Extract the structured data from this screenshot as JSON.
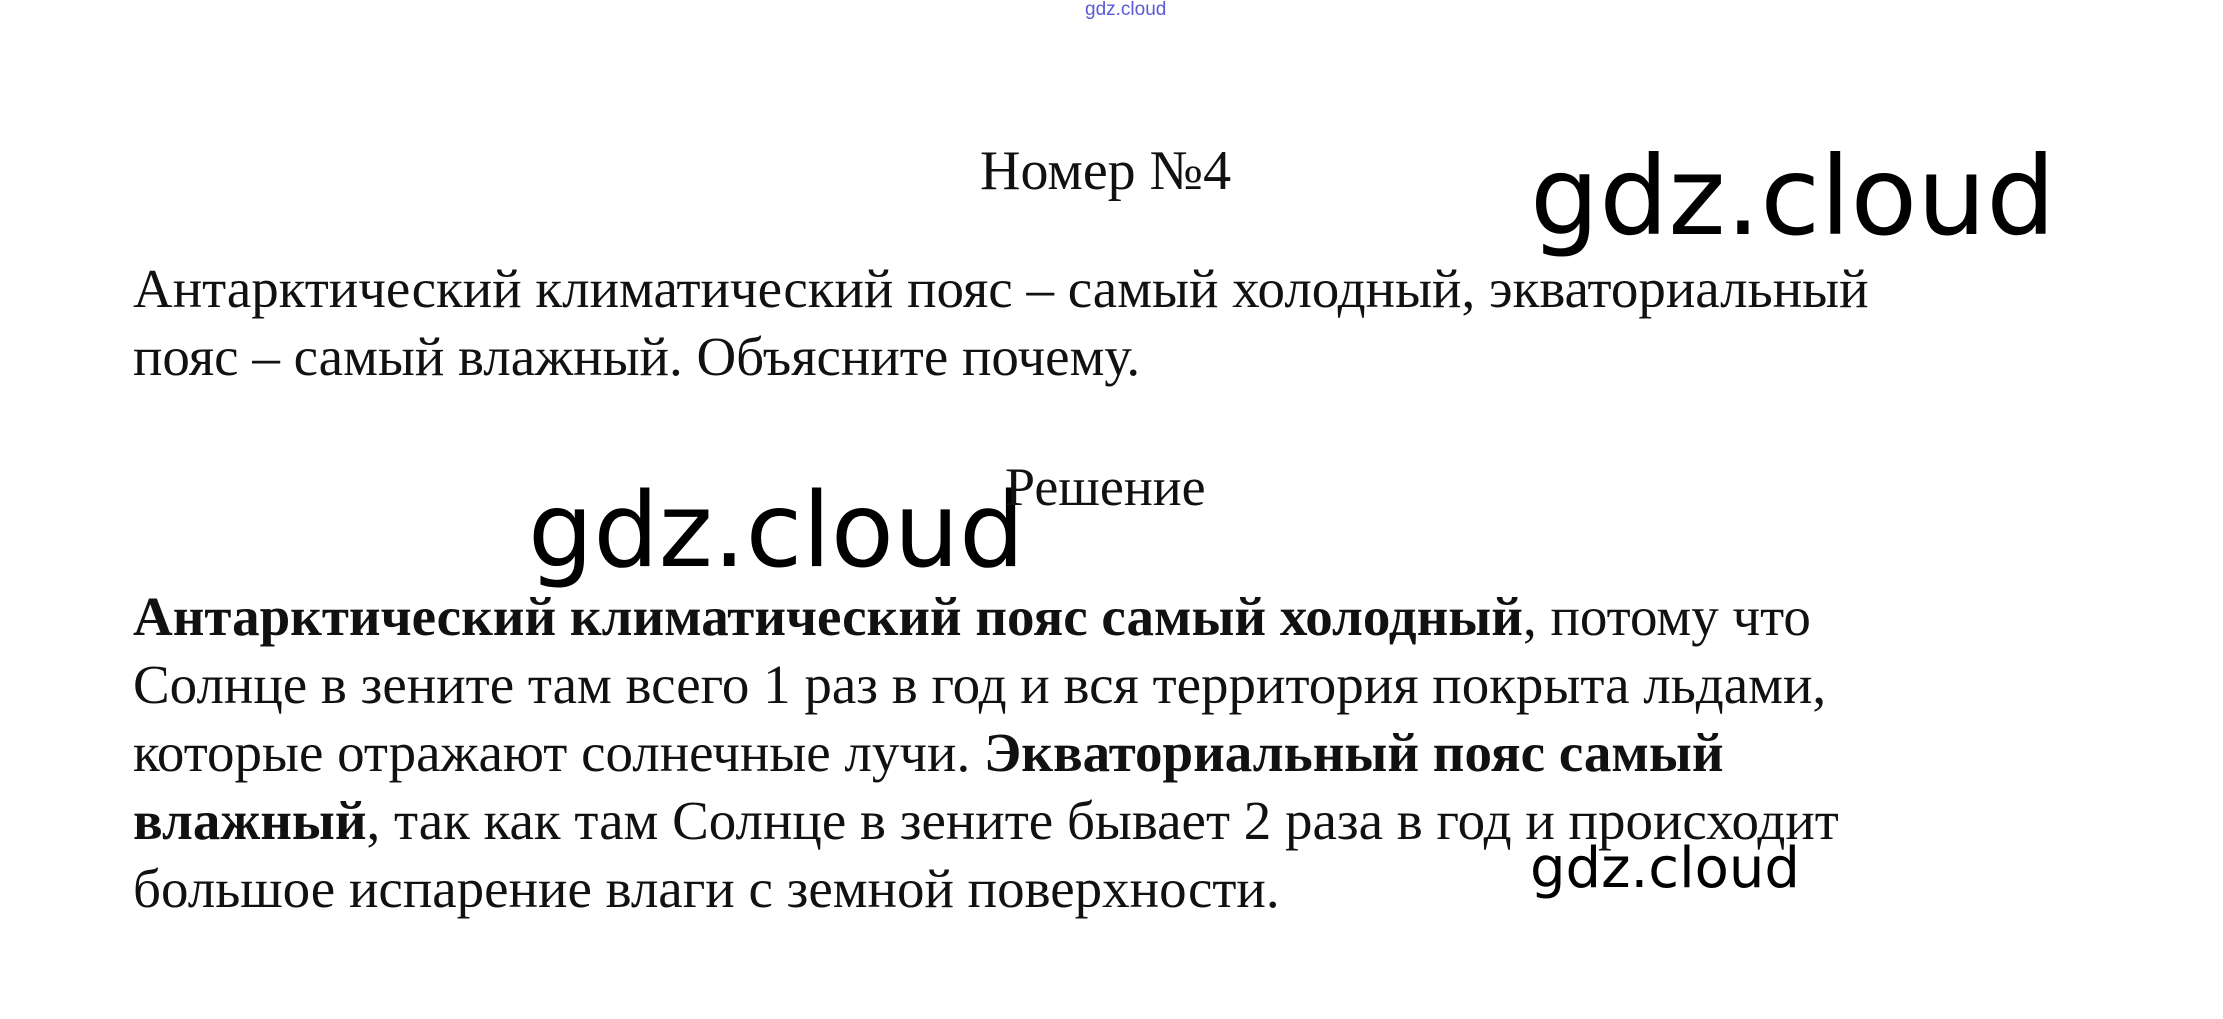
{
  "header": {
    "site_mark": "gdz.cloud"
  },
  "title": "Номер №4",
  "question": {
    "lines": [
      "Антарктический климатический пояс – самый холодный, экваториальный",
      "пояс – самый влажный. Объясните почему."
    ]
  },
  "solution_title": "Решение",
  "answer": {
    "l1_bold": "Антарктический климатический пояс самый холодный",
    "l1_rest": ", потому что",
    "l2": "Солнце в зените там всего 1 раз в год и вся территория покрыта льдами,",
    "l3_start": "которые отражают солнечные лучи. ",
    "l3_bold": "Экваториальный пояс самый",
    "l4_bold": "влажный",
    "l4_rest": ", так как там Солнце в зените бывает 2 раза в год и происходит",
    "l5": "большое испарение влаги с земной поверхности."
  },
  "watermarks": [
    "gdz.cloud",
    "gdz.cloud",
    "gdz.cloud"
  ]
}
